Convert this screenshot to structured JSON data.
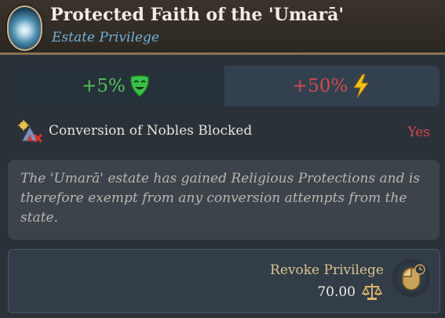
{
  "header": {
    "title": "Protected Faith of the 'Umarā'",
    "subtitle": "Estate Privilege",
    "icon": "estate-privilege-portrait-icon"
  },
  "stats": {
    "left_value": "+5%",
    "left_icon": "happy-mask-icon",
    "right_value": "+50%",
    "right_icon": "lightning-bolt-icon"
  },
  "effect": {
    "label": "Conversion of Nobles Blocked",
    "value": "Yes",
    "icon": "conversion-blocked-icon"
  },
  "description": "The 'Umarā' estate has gained Religious Protections and is therefore exempt from any conversion attempts from the state.",
  "revoke": {
    "label": "Revoke Privilege",
    "cost": "70.00",
    "cost_icon": "scales-icon",
    "button_icon": "mouse-click-icon"
  },
  "colors": {
    "positive": "#52c35a",
    "negative": "#d14b4b",
    "subtitle": "#6fb1d8",
    "gold": "#dcc48f"
  }
}
